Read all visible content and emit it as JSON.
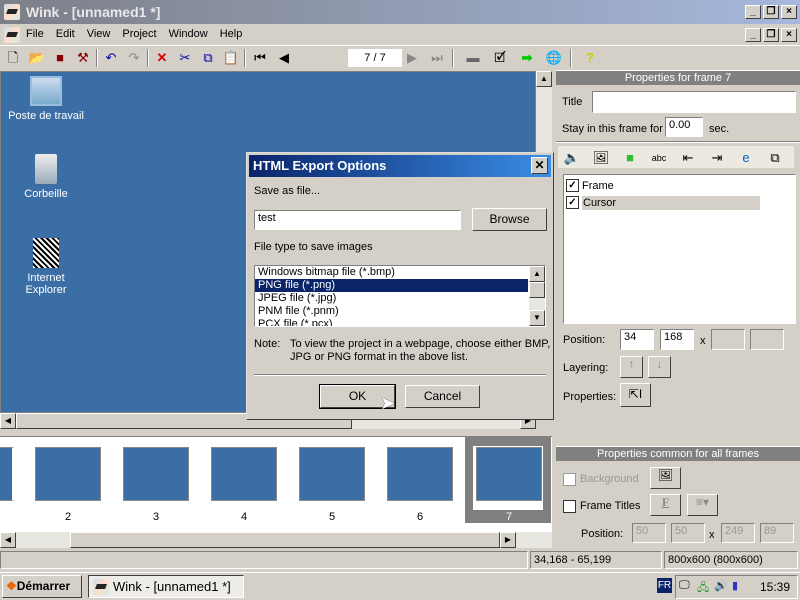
{
  "window": {
    "title": "Wink - [unnamed1 *]"
  },
  "menu": [
    "File",
    "Edit",
    "View",
    "Project",
    "Window",
    "Help"
  ],
  "toolbar": {
    "frame_counter": "7 / 7"
  },
  "desktop": {
    "icons": [
      "Poste de travail",
      "Corbeille",
      "Internet Explorer"
    ]
  },
  "dialog": {
    "title": "HTML Export Options",
    "save_label": "Save as file...",
    "filename": "test",
    "browse": "Browse",
    "filetype_label": "File type to save images",
    "filetypes": [
      "Windows bitmap file (*.bmp)",
      "PNG file (*.png)",
      "JPEG file (*.jpg)",
      "PNM file (*.pnm)",
      "PCX file (*.pcx)"
    ],
    "selected": "PNG file (*.png)",
    "note_label": "Note:",
    "note": "To view the project in a webpage, choose either BMP, JPG or PNG format in the above list.",
    "ok": "OK",
    "cancel": "Cancel"
  },
  "frame_props": {
    "header": "Properties for frame 7",
    "title_label": "Title",
    "title_value": "",
    "stay_label": "Stay in this frame for",
    "stay_value": "0.00",
    "stay_unit": "sec.",
    "objects": [
      {
        "label": "Frame",
        "checked": true
      },
      {
        "label": "Cursor",
        "checked": true
      }
    ],
    "position_label": "Position:",
    "pos_x": "34",
    "pos_y": "168",
    "x_sep": "x",
    "layering_label": "Layering:",
    "properties_label": "Properties:"
  },
  "common_props": {
    "header": "Properties common for all frames",
    "background": "Background",
    "frame_titles": "Frame Titles",
    "position_label": "Position:",
    "pos": [
      "50",
      "50",
      "249",
      "89"
    ],
    "x_sep": "x",
    "font_btn": "F"
  },
  "filmstrip": {
    "labels": [
      "2",
      "3",
      "4",
      "5",
      "6",
      "7"
    ],
    "selected": "7"
  },
  "status": {
    "coords": "34,168 - 65,199",
    "size": "800x600 (800x600)"
  },
  "taskbar": {
    "start": "Démarrer",
    "task": "Wink - [unnamed1 *]",
    "lang": "FR",
    "clock": "15:39"
  },
  "colors": {
    "desktop": "#3a6ea5",
    "selection": "#0a246a"
  }
}
